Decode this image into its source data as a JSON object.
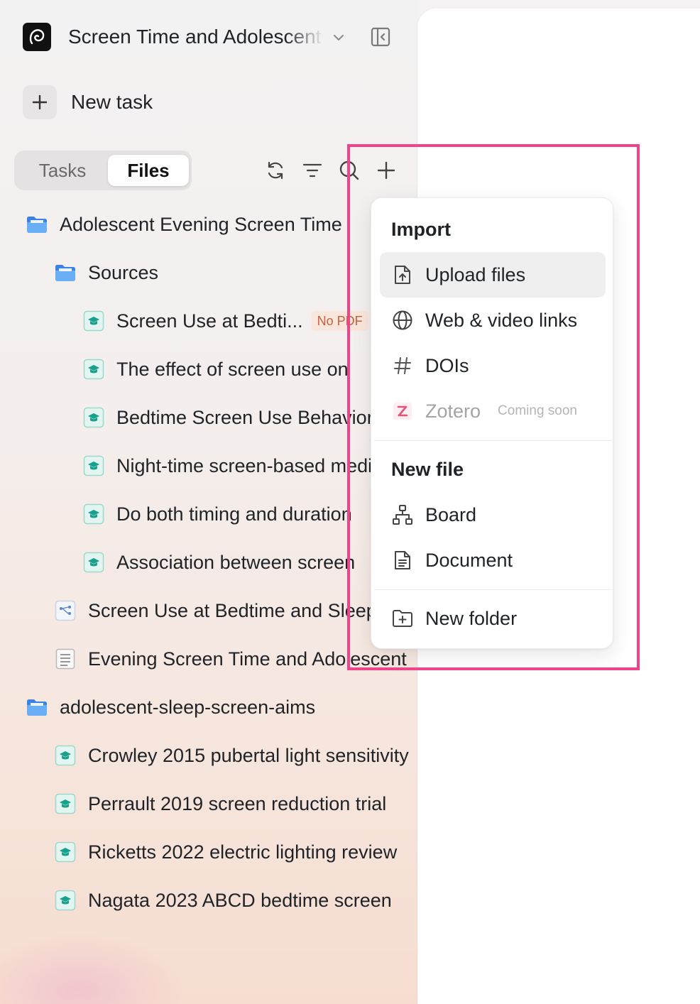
{
  "header": {
    "workspace_title": "Screen Time and Adolescent Sleep"
  },
  "new_task": {
    "label": "New task"
  },
  "tabs": [
    {
      "label": "Tasks",
      "selected": false
    },
    {
      "label": "Files",
      "selected": true
    }
  ],
  "tree": {
    "project_folder": {
      "label": "Adolescent Evening Screen Time"
    },
    "sources_folder": {
      "label": "Sources"
    },
    "sources": [
      {
        "label": "Screen Use at Bedti...",
        "badge": "No PDF"
      },
      {
        "label": "The effect of screen use on"
      },
      {
        "label": "Bedtime Screen Use Behaviors"
      },
      {
        "label": "Night-time screen-based media"
      },
      {
        "label": "Do both timing and duration"
      },
      {
        "label": "Association between screen"
      }
    ],
    "board_file": {
      "label": "Screen Use at Bedtime and Sleep"
    },
    "document_file": {
      "label": "Evening Screen Time and Adolescent"
    },
    "second_folder": {
      "label": "adolescent-sleep-screen-aims"
    },
    "second_folder_items": [
      {
        "label": "Crowley 2015 pubertal light sensitivity"
      },
      {
        "label": "Perrault 2019 screen reduction trial"
      },
      {
        "label": "Ricketts 2022 electric lighting review"
      },
      {
        "label": "Nagata 2023 ABCD bedtime screen"
      }
    ]
  },
  "menu": {
    "import_heading": "Import",
    "upload_files": "Upload files",
    "web_video_links": "Web & video links",
    "dois": "DOIs",
    "zotero": "Zotero",
    "zotero_status": "Coming soon",
    "new_file_heading": "New file",
    "board": "Board",
    "document": "Document",
    "new_folder": "New folder"
  },
  "colors": {
    "highlight": "#f0448a",
    "paper_icon": "#17a08c",
    "folder_icon": "#5a9ff0",
    "badge_text": "#c0623d"
  }
}
